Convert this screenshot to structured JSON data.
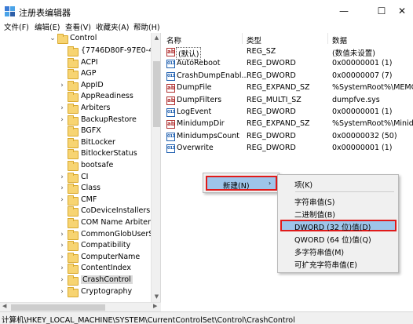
{
  "window": {
    "title": "注册表编辑器",
    "icons": {
      "app": "registry-editor-icon",
      "minimize": "minimize-icon",
      "maximize": "maximize-icon",
      "close": "close-icon"
    }
  },
  "menu": [
    "文件(F)",
    "编辑(E)",
    "查看(V)",
    "收藏夹(A)",
    "帮助(H)"
  ],
  "tree": {
    "parent": "Control",
    "items": [
      {
        "label": "{7746D80F-97E0-4E2",
        "expandable": false
      },
      {
        "label": "ACPI",
        "expandable": false
      },
      {
        "label": "AGP",
        "expandable": false
      },
      {
        "label": "AppID",
        "expandable": true
      },
      {
        "label": "AppReadiness",
        "expandable": false
      },
      {
        "label": "Arbiters",
        "expandable": true
      },
      {
        "label": "BackupRestore",
        "expandable": true
      },
      {
        "label": "BGFX",
        "expandable": false
      },
      {
        "label": "BitLocker",
        "expandable": false
      },
      {
        "label": "BitlockerStatus",
        "expandable": false
      },
      {
        "label": "bootsafe",
        "expandable": false
      },
      {
        "label": "CI",
        "expandable": true
      },
      {
        "label": "Class",
        "expandable": true
      },
      {
        "label": "CMF",
        "expandable": true
      },
      {
        "label": "CoDeviceInstallers",
        "expandable": false
      },
      {
        "label": "COM Name Arbiter",
        "expandable": false
      },
      {
        "label": "CommonGlobUserSe",
        "expandable": true
      },
      {
        "label": "Compatibility",
        "expandable": true
      },
      {
        "label": "ComputerName",
        "expandable": true
      },
      {
        "label": "ContentIndex",
        "expandable": true
      },
      {
        "label": "CrashControl",
        "expandable": true,
        "selected": true
      },
      {
        "label": "Cryptography",
        "expandable": true
      }
    ]
  },
  "columns": {
    "name": "名称",
    "type": "类型",
    "data": "数据"
  },
  "values": [
    {
      "icon": "string",
      "name": "(默认)",
      "type": "REG_SZ",
      "data": "(数值未设置)"
    },
    {
      "icon": "binary",
      "name": "AutoReboot",
      "type": "REG_DWORD",
      "data": "0x00000001 (1)"
    },
    {
      "icon": "binary",
      "name": "CrashDumpEnabl...",
      "type": "REG_DWORD",
      "data": "0x00000007 (7)"
    },
    {
      "icon": "string",
      "name": "DumpFile",
      "type": "REG_EXPAND_SZ",
      "data": "%SystemRoot%\\MEMOR"
    },
    {
      "icon": "string",
      "name": "DumpFilters",
      "type": "REG_MULTI_SZ",
      "data": "dumpfve.sys"
    },
    {
      "icon": "binary",
      "name": "LogEvent",
      "type": "REG_DWORD",
      "data": "0x00000001 (1)"
    },
    {
      "icon": "string",
      "name": "MinidumpDir",
      "type": "REG_EXPAND_SZ",
      "data": "%SystemRoot%\\Minidum"
    },
    {
      "icon": "binary",
      "name": "MinidumpsCount",
      "type": "REG_DWORD",
      "data": "0x00000032 (50)"
    },
    {
      "icon": "binary",
      "name": "Overwrite",
      "type": "REG_DWORD",
      "data": "0x00000001 (1)"
    }
  ],
  "icon_glyphs": {
    "string": "ab",
    "binary": "011"
  },
  "context_menu": {
    "new_label": "新建(N)",
    "arrow": "›"
  },
  "submenu": [
    {
      "label": "项(K)"
    },
    {
      "separator": true
    },
    {
      "label": "字符串值(S)"
    },
    {
      "label": "二进制值(B)"
    },
    {
      "label": "DWORD (32 位)值(D)",
      "highlighted": true
    },
    {
      "label": "QWORD (64 位)值(Q)"
    },
    {
      "label": "多字符串值(M)"
    },
    {
      "label": "可扩充字符串值(E)"
    }
  ],
  "status": "计算机\\HKEY_LOCAL_MACHINE\\SYSTEM\\CurrentControlSet\\Control\\CrashControl",
  "colors": {
    "highlight": "#9ec5ea",
    "outline": "#e01a1a",
    "folder": "#f7d472"
  }
}
